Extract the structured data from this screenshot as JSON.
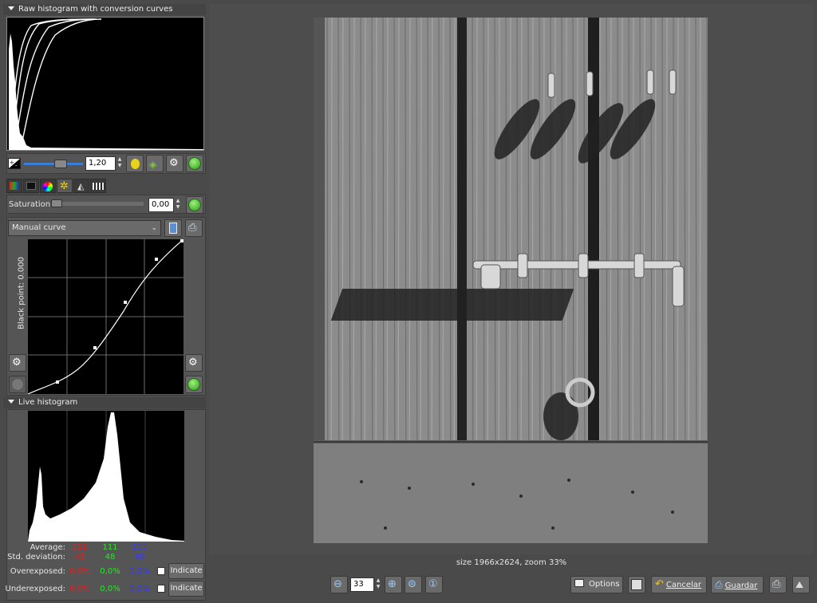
{
  "raw_histogram": {
    "title": "Raw histogram with conversion curves"
  },
  "exposure": {
    "value": "1,20"
  },
  "saturation": {
    "label": "Saturation",
    "value": "0,00"
  },
  "curve": {
    "preset": "Manual curve",
    "black_point_label": "Black point: 0.000"
  },
  "live_histogram": {
    "title": "Live histogram",
    "average_label": "Average:",
    "std_label": "Std. deviation:",
    "over_label": "Overexposed:",
    "under_label": "Underexposed:",
    "average": [
      "111",
      "111",
      "111"
    ],
    "std": [
      "48",
      "48",
      "48"
    ],
    "over": [
      "0,0%",
      "0,0%",
      "0,0%"
    ],
    "under": [
      "0,0%",
      "0,0%",
      "0,0%"
    ],
    "indicate_label": "Indicate"
  },
  "image_info": "size 1966x2624, zoom 33%",
  "zoom": {
    "value": "33"
  },
  "buttons": {
    "options": "Options",
    "cancel": "Cancelar",
    "save": "Guardar"
  },
  "colors": {
    "accent_blue": "#3a7fd5",
    "red": "#e02020",
    "green": "#30e030",
    "blue": "#3838ff"
  }
}
